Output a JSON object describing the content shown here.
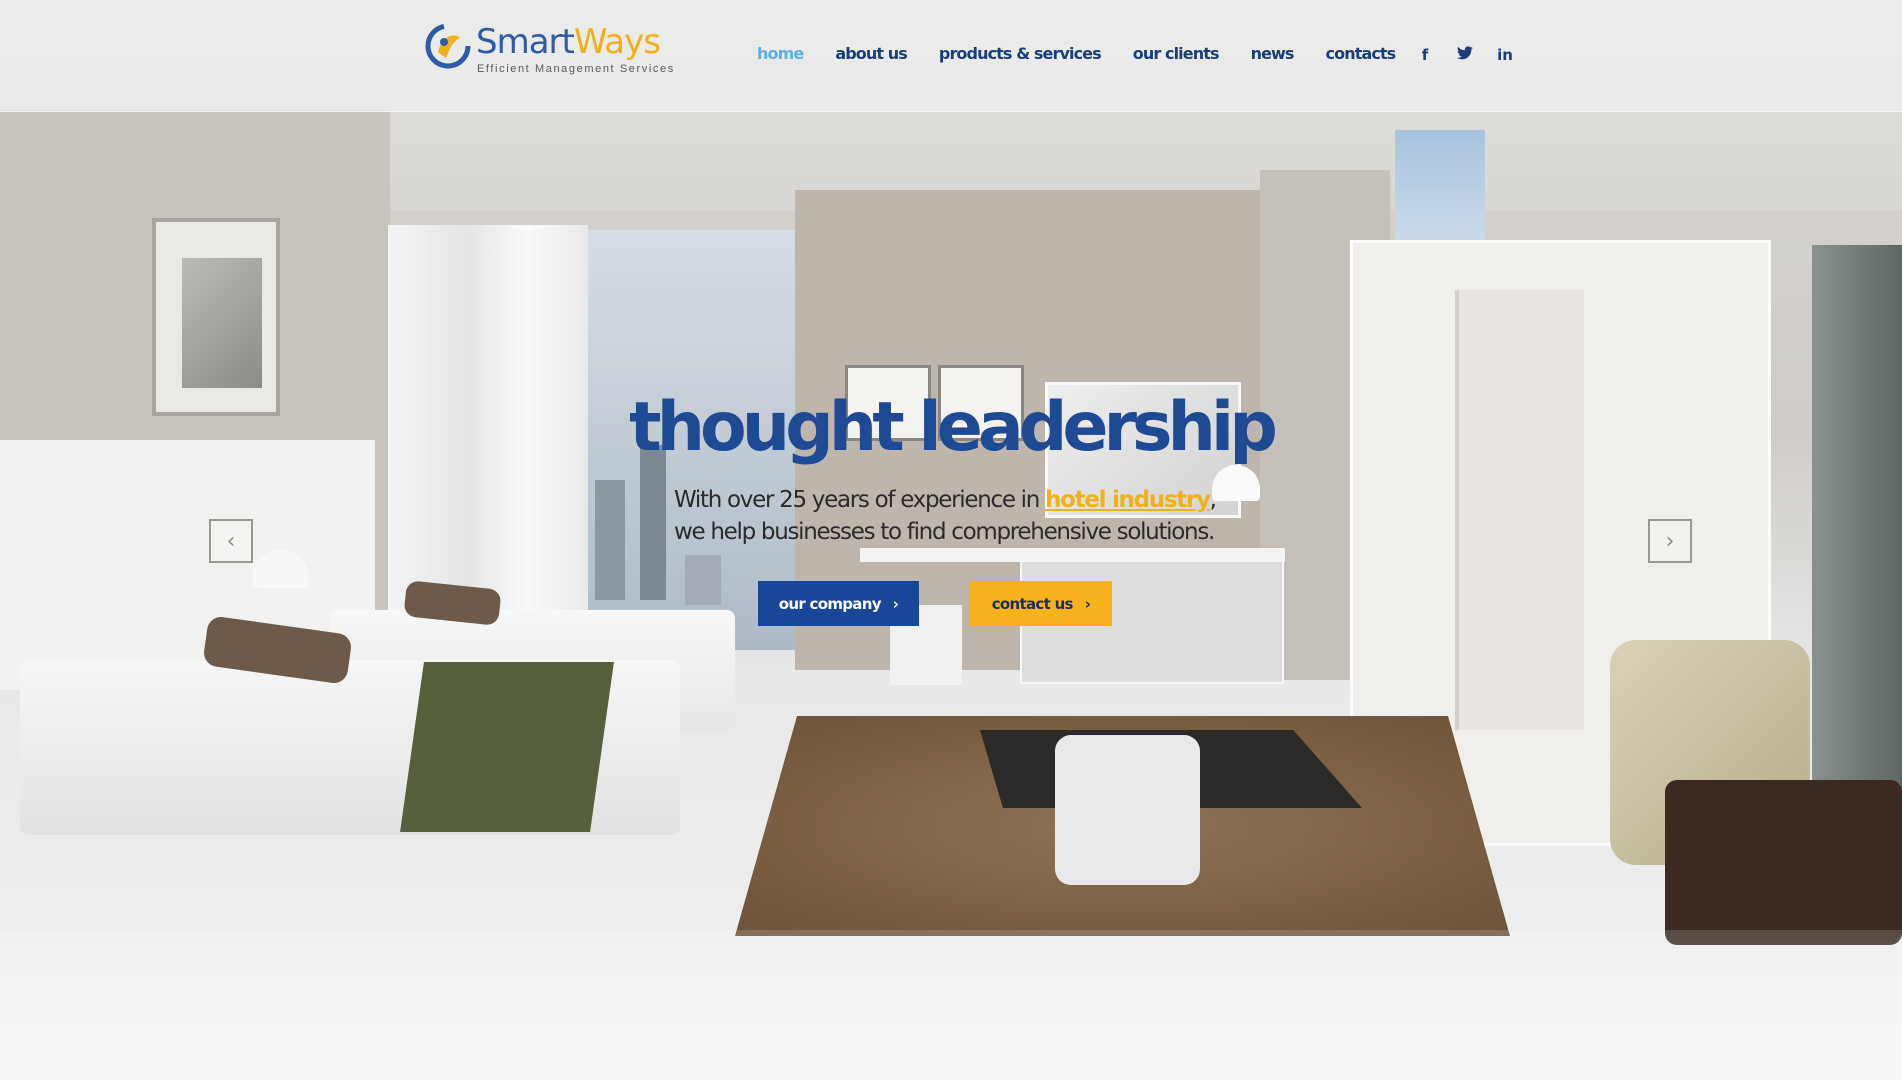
{
  "brand": {
    "name_part1": "Smart",
    "name_part2": "Ways",
    "tagline": "Efficient Management Services",
    "colors": {
      "blue": "#2e5aa8",
      "yellow": "#f2b11a",
      "nav": "#1b3e7a",
      "active": "#5fb0e0"
    }
  },
  "nav": {
    "items": [
      {
        "label": "home",
        "active": true
      },
      {
        "label": "about us",
        "active": false
      },
      {
        "label": "products & services",
        "active": false
      },
      {
        "label": "our clients",
        "active": false
      },
      {
        "label": "news",
        "active": false
      },
      {
        "label": "contacts",
        "active": false
      }
    ]
  },
  "social": {
    "facebook": "f",
    "twitter": "🐦",
    "linkedin": "in",
    "icons": [
      "facebook-icon",
      "twitter-icon",
      "linkedin-icon"
    ]
  },
  "hero": {
    "headline": "thought leadership",
    "line1_before": "With over 25 years of experience in ",
    "line1_highlight": "hotel industry",
    "line1_after": ",",
    "line2": "we help businesses to find comprehensive solutions.",
    "button_primary": "our company",
    "button_secondary": "contact us",
    "chevron": "›",
    "prev_arrow": "‹",
    "next_arrow": "›"
  }
}
